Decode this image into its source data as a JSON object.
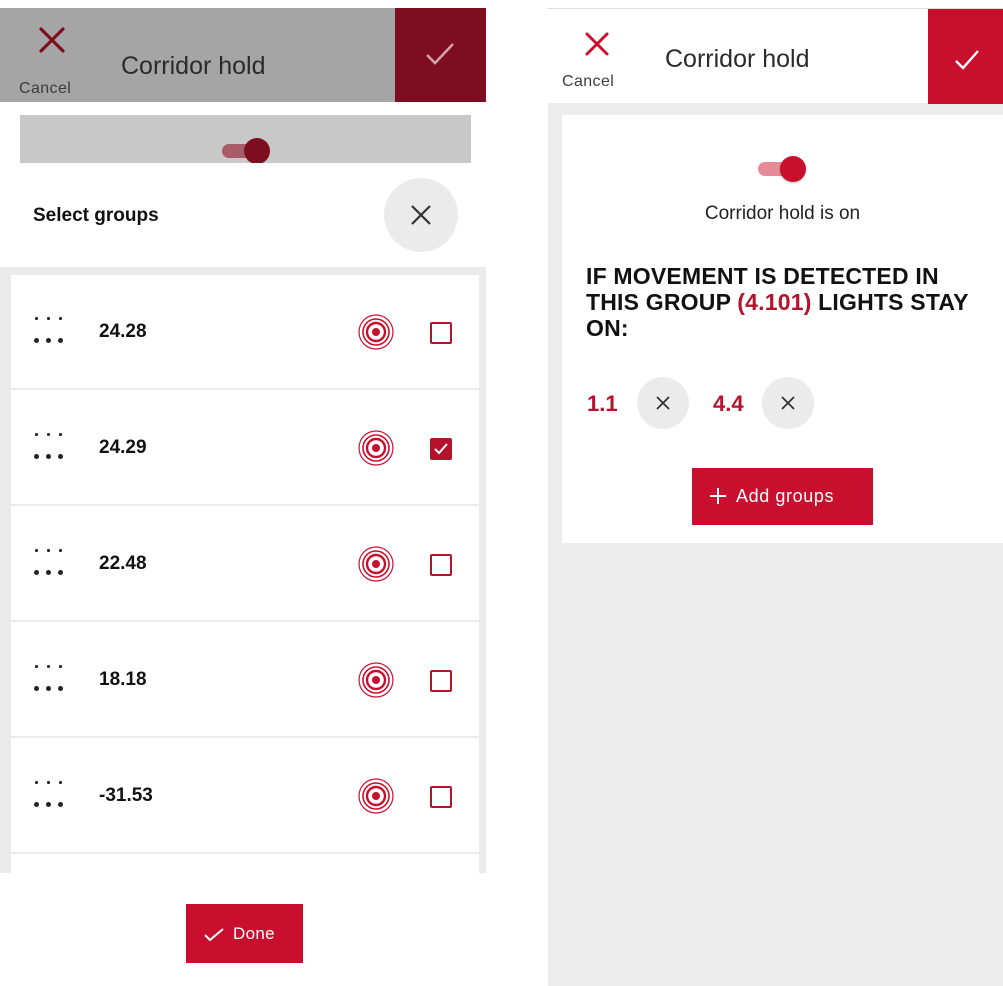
{
  "colors": {
    "accent": "#c8102e",
    "accent_dimmed": "#7e0e1f",
    "accent_text": "#b5132c",
    "scrim": "#a5a5a5",
    "background_gray": "#ececec"
  },
  "left": {
    "header": {
      "cancel_icon": "close-icon",
      "cancel_label": "Cancel",
      "title": "Corridor hold",
      "confirm_icon": "check-icon"
    },
    "sheet": {
      "title": "Select groups",
      "close_icon": "close-icon",
      "groups": [
        {
          "name": "24.28",
          "selected": false
        },
        {
          "name": "24.29",
          "selected": true
        },
        {
          "name": "22.48",
          "selected": false
        },
        {
          "name": "18.18",
          "selected": false
        },
        {
          "name": "-31.53",
          "selected": false
        }
      ],
      "group_icon": "group-dots-icon",
      "sensor_icon": "motion-sensor-icon",
      "done_label": "Done",
      "done_icon": "check-icon"
    }
  },
  "right": {
    "header": {
      "cancel_icon": "close-icon",
      "cancel_label": "Cancel",
      "title": "Corridor hold",
      "confirm_icon": "check-icon"
    },
    "toggle_on": true,
    "status": "Corridor hold is on",
    "heading": {
      "part1": "IF MOVEMENT IS DETECTED IN THIS GROUP ",
      "group": "(4.101)",
      "part2": " LIGHTS STAY ON:"
    },
    "selected_groups": [
      "1.1",
      "4.4"
    ],
    "remove_icon": "close-icon",
    "add_label": "Add groups",
    "add_icon": "plus-icon"
  }
}
